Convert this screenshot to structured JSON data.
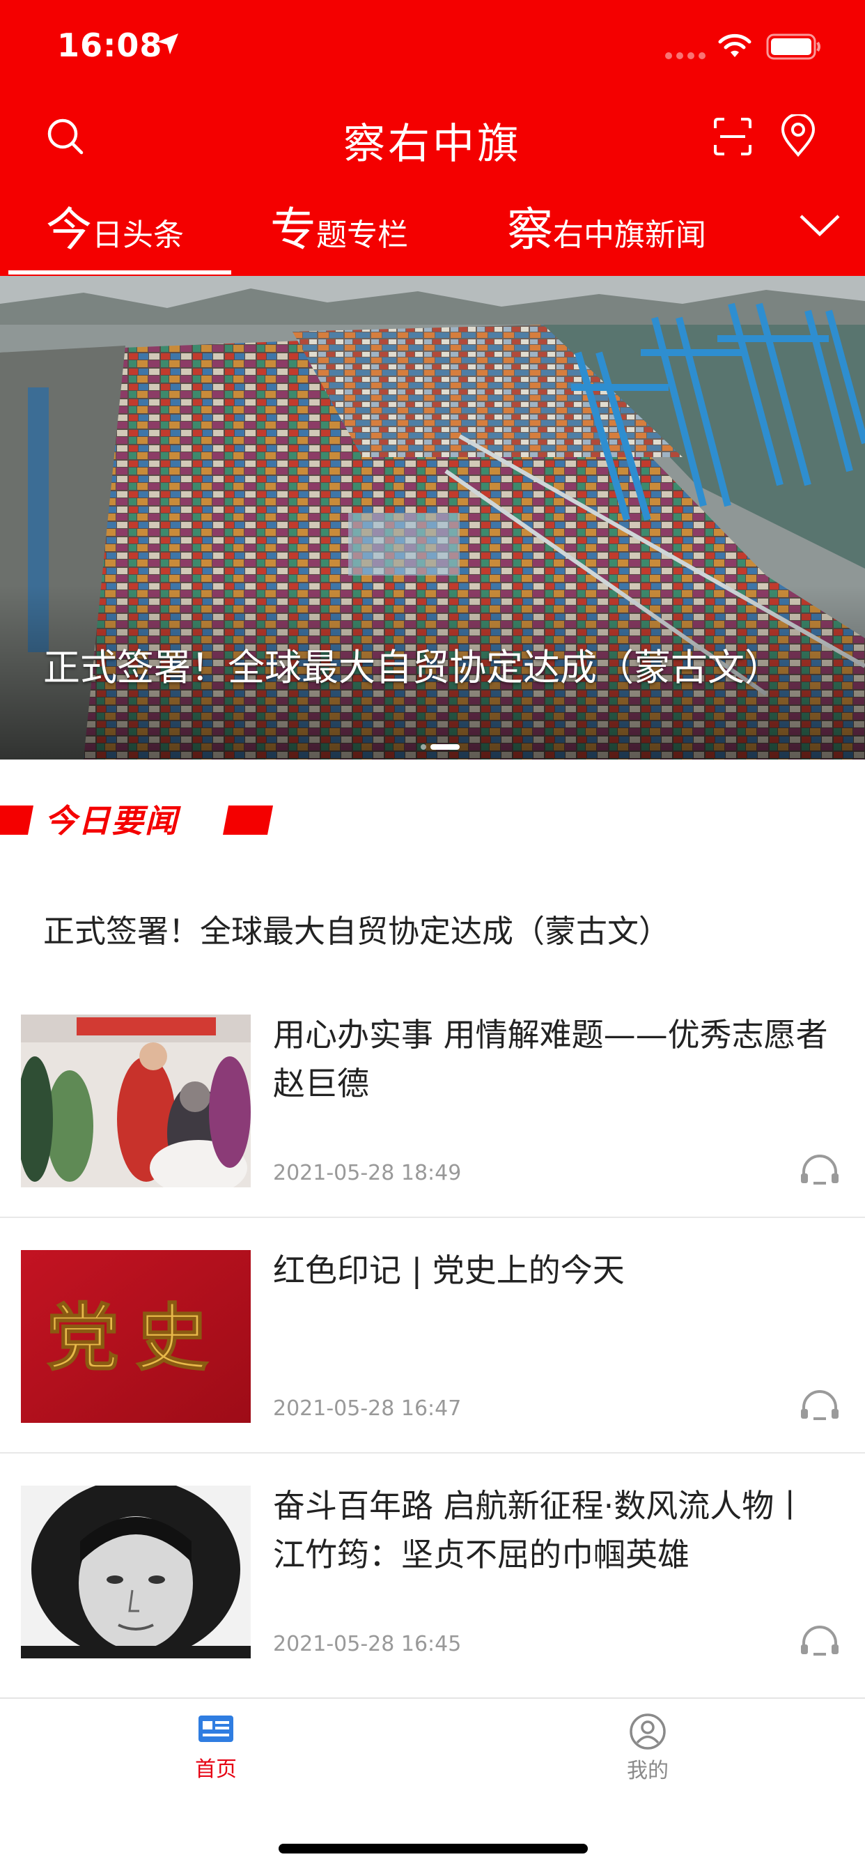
{
  "status_bar": {
    "time": "16:08"
  },
  "header": {
    "title": "察右中旗",
    "tabs": [
      {
        "first": "今",
        "rest": "日头条",
        "active": true
      },
      {
        "first": "专",
        "rest": "题专栏",
        "active": false
      },
      {
        "first": "察",
        "rest": "右中旗新闻",
        "active": false
      }
    ]
  },
  "banner": {
    "caption": "正式签署！全球最大自贸协定达成（蒙古文）"
  },
  "section": {
    "heading": "今日要闻"
  },
  "headline": "正式签署！全球最大自贸协定达成（蒙古文）",
  "news": [
    {
      "title": "用心办实事 用情解难题——优秀志愿者赵巨德",
      "date": "2021-05-28 18:49"
    },
    {
      "title": "红色印记 | 党史上的今天",
      "date": "2021-05-28 16:47",
      "thumb_text": "党史"
    },
    {
      "title": "奋斗百年路 启航新征程·数风流人物丨江竹筠：坚贞不屈的巾帼英雄",
      "date": "2021-05-28 16:45"
    }
  ],
  "tabbar": {
    "home": "首页",
    "mine": "我的"
  },
  "colors": {
    "brand_red": "#f40000",
    "tab_active": "#e60012",
    "tab_inactive": "#8a8a8a",
    "home_icon_blue": "#2f7de1"
  },
  "icons": [
    "location-arrow-icon",
    "cellular-icon",
    "wifi-icon",
    "battery-icon",
    "search-icon",
    "scan-icon",
    "location-pin-icon",
    "chevron-down-icon",
    "headphones-icon",
    "news-icon",
    "user-icon"
  ]
}
